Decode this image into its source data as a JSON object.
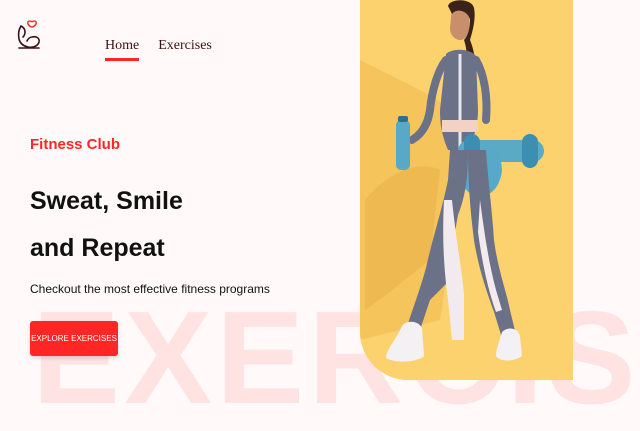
{
  "nav": {
    "items": [
      {
        "label": "Home",
        "active": true
      },
      {
        "label": "Exercises",
        "active": false
      }
    ]
  },
  "logo": {
    "icon": "muscle-arm-heart-icon"
  },
  "hero": {
    "eyebrow": "Fitness Club",
    "headline_line1": "Sweat, Smile",
    "headline_line2": "and Repeat",
    "subtext": "Checkout the most effective fitness programs",
    "cta_label": "EXPLORE EXERCISES",
    "background_word": "EXERCISE",
    "image": "woman walking with gym bag and water bottle on yellow background"
  },
  "colors": {
    "accent": "#ff2625",
    "page_bg": "#fff9f9",
    "image_bg": "#fbd26d"
  }
}
